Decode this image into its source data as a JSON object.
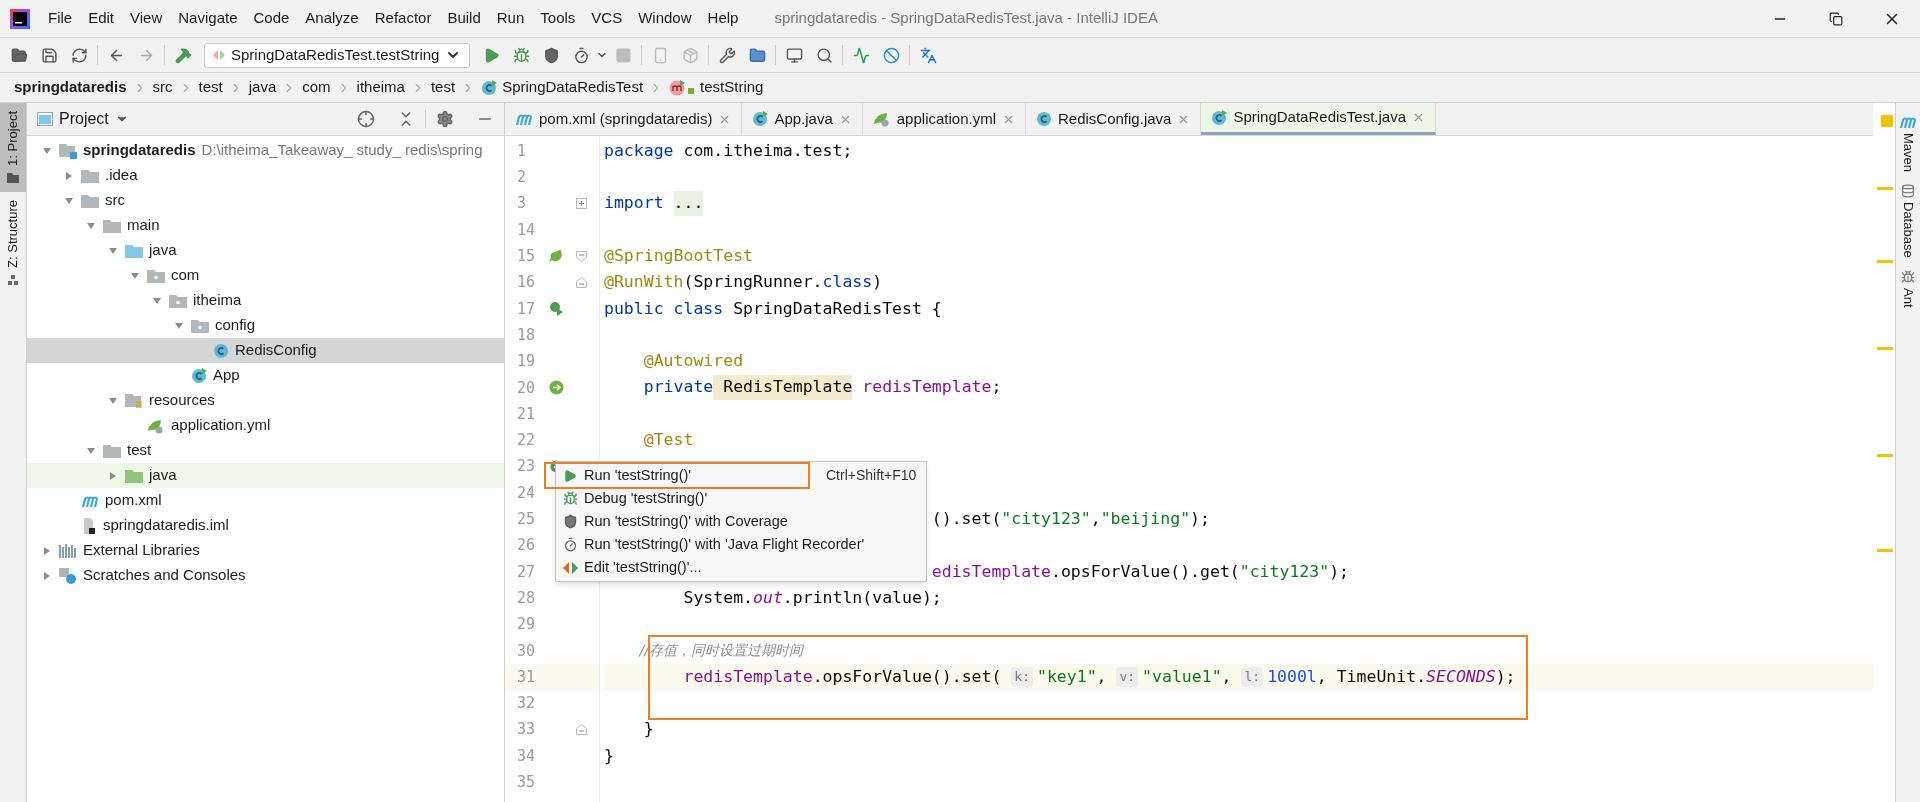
{
  "window": {
    "title": "springdataredis - SpringDataRedisTest.java - IntelliJ IDEA"
  },
  "menu": [
    "File",
    "Edit",
    "View",
    "Navigate",
    "Code",
    "Analyze",
    "Refactor",
    "Build",
    "Run",
    "Tools",
    "VCS",
    "Window",
    "Help"
  ],
  "toolbar": {
    "run_configuration": "SpringDataRedisTest.testString"
  },
  "breadcrumbs": [
    {
      "text": "springdataredis",
      "kind": "project"
    },
    {
      "text": "src",
      "kind": "dir"
    },
    {
      "text": "test",
      "kind": "dir"
    },
    {
      "text": "java",
      "kind": "dir"
    },
    {
      "text": "com",
      "kind": "dir"
    },
    {
      "text": "itheima",
      "kind": "dir"
    },
    {
      "text": "test",
      "kind": "dir"
    },
    {
      "text": "SpringDataRedisTest",
      "kind": "class"
    },
    {
      "text": "testString",
      "kind": "method"
    }
  ],
  "left_stripe": [
    {
      "label": "1: Project",
      "selected": true
    },
    {
      "label": "Z: Structure",
      "selected": false
    }
  ],
  "right_stripe": [
    {
      "label": "Maven",
      "kind": "maven"
    },
    {
      "label": "Database",
      "kind": "database"
    },
    {
      "label": "Ant",
      "kind": "ant"
    }
  ],
  "project_panel": {
    "title": "Project",
    "tree": [
      {
        "name": "springdataredis",
        "path": "D:\\itheima_Takeaway_ study_ redis\\spring",
        "kind": "module",
        "expanded": true,
        "selected": false,
        "children": [
          {
            "name": ".idea",
            "kind": "folder",
            "expanded": false,
            "selected": false
          },
          {
            "name": "src",
            "kind": "folder",
            "expanded": true,
            "selected": false,
            "children": [
              {
                "name": "main",
                "kind": "folder",
                "expanded": true,
                "selected": false,
                "children": [
                  {
                    "name": "java",
                    "kind": "source",
                    "expanded": true,
                    "selected": false,
                    "children": [
                      {
                        "name": "com",
                        "kind": "package",
                        "expanded": true,
                        "selected": false,
                        "children": [
                          {
                            "name": "itheima",
                            "kind": "package",
                            "expanded": true,
                            "selected": false,
                            "children": [
                              {
                                "name": "config",
                                "kind": "package",
                                "expanded": true,
                                "selected": false,
                                "children": [
                                  {
                                    "name": "RedisConfig",
                                    "kind": "class",
                                    "selected": true
                                  }
                                ]
                              },
                              {
                                "name": "App",
                                "kind": "app",
                                "selected": false
                              }
                            ]
                          }
                        ]
                      }
                    ]
                  },
                  {
                    "name": "resources",
                    "kind": "resources",
                    "expanded": true,
                    "selected": false,
                    "children": [
                      {
                        "name": "application.yml",
                        "kind": "yml",
                        "selected": false
                      }
                    ]
                  }
                ]
              },
              {
                "name": "test",
                "kind": "folder",
                "expanded": true,
                "selected": false,
                "children": [
                  {
                    "name": "java",
                    "kind": "test",
                    "expanded": false,
                    "selected": false
                  }
                ]
              }
            ]
          },
          {
            "name": "pom.xml",
            "kind": "maven",
            "selected": false
          },
          {
            "name": "springdataredis.iml",
            "kind": "iml",
            "selected": false
          }
        ]
      },
      {
        "name": "External Libraries",
        "kind": "libraries",
        "expanded": false,
        "selected": false
      },
      {
        "name": "Scratches and Consoles",
        "kind": "scratches",
        "expanded": false,
        "selected": false
      }
    ]
  },
  "tabs": [
    {
      "label": "pom.xml (springdataredis)",
      "kind": "maven",
      "selected": false
    },
    {
      "label": "App.java",
      "kind": "app",
      "selected": false
    },
    {
      "label": "application.yml",
      "kind": "yml",
      "selected": false
    },
    {
      "label": "RedisConfig.java",
      "kind": "class",
      "selected": false
    },
    {
      "label": "SpringDataRedisTest.java",
      "kind": "test",
      "selected": true
    }
  ],
  "editor": {
    "lines": [
      {
        "number": "1",
        "tokens": [
          {
            "kind": "kw",
            "text": "package"
          },
          {
            "kind": "plain",
            "text": " com.itheima.test;"
          }
        ]
      },
      {
        "number": "2"
      },
      {
        "number": "3",
        "fold": {
          "kind": "collapsed"
        },
        "tokens": [
          {
            "kind": "kw",
            "text": "import "
          },
          {
            "kind": "folded",
            "text": "..."
          }
        ]
      },
      {
        "number": "14"
      },
      {
        "number": "15",
        "gutter": {
          "kind": "spring"
        },
        "fold": {
          "kind": "start"
        },
        "tokens": [
          {
            "kind": "ann",
            "text": "@SpringBootTest"
          }
        ]
      },
      {
        "number": "16",
        "fold": {
          "kind": "end"
        },
        "tokens": [
          {
            "kind": "ann",
            "text": "@RunWith"
          },
          {
            "kind": "plain",
            "text": "(SpringRunner."
          },
          {
            "kind": "kw",
            "text": "class"
          },
          {
            "kind": "plain",
            "text": ")"
          }
        ]
      },
      {
        "number": "17",
        "gutter": {
          "kind": "run-class"
        },
        "tokens": [
          {
            "kind": "kw",
            "text": "public class"
          },
          {
            "kind": "plain",
            "text": " SpringDataRedisTest {"
          }
        ]
      },
      {
        "number": "18"
      },
      {
        "number": "19",
        "tokens": [
          {
            "kind": "ann",
            "text": "    @Autowired"
          }
        ]
      },
      {
        "number": "20",
        "gutter": {
          "kind": "bean"
        },
        "tokens": [
          {
            "kind": "kw",
            "text": "    private"
          },
          {
            "kind": "type",
            "text": " RedisTemplate"
          },
          {
            "kind": "field",
            "text": " redisTemplate"
          },
          {
            "kind": "plain",
            "text": ";"
          }
        ]
      },
      {
        "number": "21"
      },
      {
        "number": "22",
        "tokens": [
          {
            "kind": "ann",
            "text": "    @Test"
          }
        ]
      },
      {
        "number": "23",
        "gutter": {
          "kind": "run"
        }
      },
      {
        "number": "24"
      },
      {
        "number": "25",
        "partial": true,
        "tokens": [
          {
            "kind": "plain",
            "text": "().set("
          },
          {
            "kind": "str",
            "text": "\"city123\""
          },
          {
            "kind": "plain",
            "text": ","
          },
          {
            "kind": "str",
            "text": "\"beijing\""
          },
          {
            "kind": "plain",
            "text": ");"
          }
        ]
      },
      {
        "number": "26"
      },
      {
        "number": "27",
        "partial": true,
        "tokens": [
          {
            "kind": "field",
            "text": "edisTemplate"
          },
          {
            "kind": "plain",
            "text": ".opsForValue().get("
          },
          {
            "kind": "str",
            "text": "\"city123\""
          },
          {
            "kind": "plain",
            "text": ");"
          }
        ]
      },
      {
        "number": "28",
        "tokens": [
          {
            "kind": "plain",
            "text": "        System."
          },
          {
            "kind": "static",
            "text": "out"
          },
          {
            "kind": "plain",
            "text": ".println(value);"
          }
        ]
      },
      {
        "number": "29"
      },
      {
        "number": "30",
        "framed": true,
        "tokens": [
          {
            "kind": "comment",
            "text": "        //存值，同时设置过期时间"
          }
        ]
      },
      {
        "number": "31",
        "framed": true,
        "current": true,
        "tokens": [
          {
            "kind": "field",
            "text": "        redisTemplate"
          },
          {
            "kind": "plain",
            "text": ".opsForValue().set( "
          },
          {
            "kind": "hint",
            "text": "k:"
          },
          {
            "kind": "str",
            "text": "\"key1\""
          },
          {
            "kind": "plain",
            "text": ", "
          },
          {
            "kind": "hint",
            "text": "v:"
          },
          {
            "kind": "str",
            "text": "\"value1\""
          },
          {
            "kind": "plain",
            "text": ", "
          },
          {
            "kind": "hint",
            "text": "l:"
          },
          {
            "kind": "num",
            "text": "1000l"
          },
          {
            "kind": "plain",
            "text": ", TimeUnit."
          },
          {
            "kind": "static",
            "text": "SECONDS"
          },
          {
            "kind": "plain",
            "text": ");"
          }
        ]
      },
      {
        "number": "32",
        "framed": true
      },
      {
        "number": "33",
        "fold": {
          "kind": "end"
        },
        "tokens": [
          {
            "kind": "plain",
            "text": "    }"
          }
        ]
      },
      {
        "number": "34",
        "tokens": [
          {
            "kind": "plain",
            "text": "}"
          }
        ]
      },
      {
        "number": "35"
      }
    ]
  },
  "popup": {
    "items": [
      {
        "kind": "run",
        "text": "Run 'testString()'",
        "shortcut": "Ctrl+Shift+F10",
        "framed": true
      },
      {
        "kind": "debug",
        "text": "Debug 'testString()'",
        "framed": false
      },
      {
        "kind": "coverage",
        "text": "Run 'testString()' with Coverage",
        "framed": false
      },
      {
        "kind": "profiler",
        "text": "Run 'testString()' with 'Java Flight Recorder'",
        "framed": false
      },
      {
        "kind": "edit",
        "text": "Edit 'testString()'...",
        "framed": false
      }
    ]
  }
}
